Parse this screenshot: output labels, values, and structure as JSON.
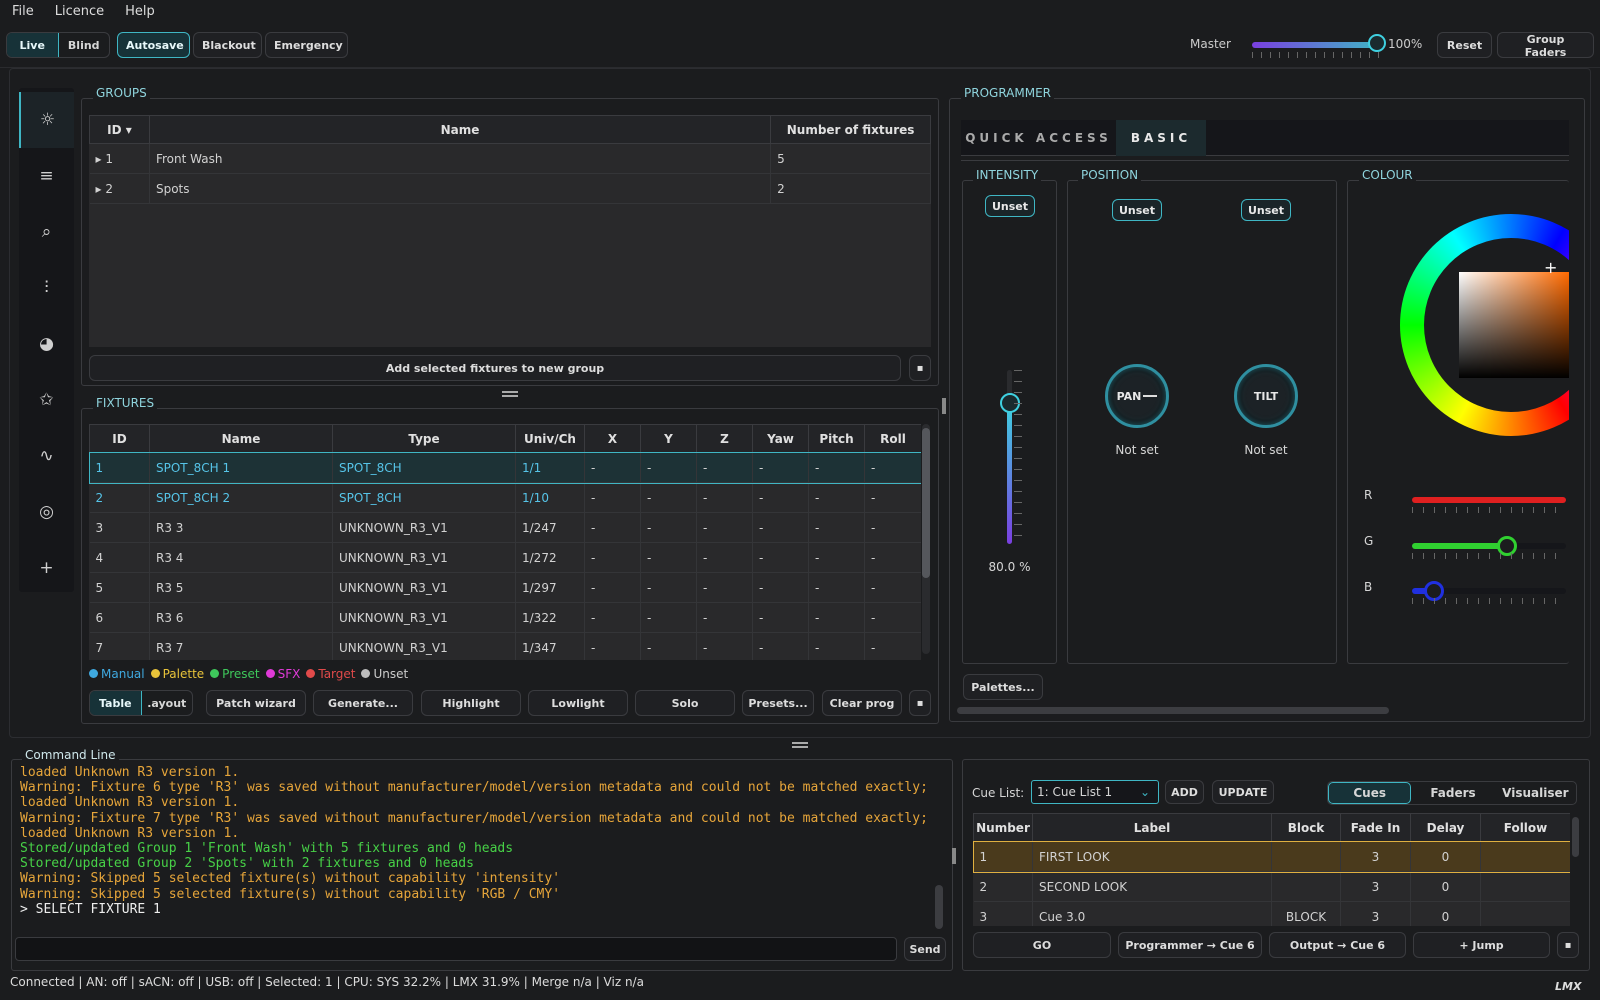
{
  "menu": [
    "File",
    "Licence",
    "Help"
  ],
  "toolbar": {
    "live": "Live",
    "blind": "Blind",
    "autosave": "Autosave",
    "blackout": "Blackout",
    "emergency": "Emergency",
    "master_label": "Master",
    "master_value": "100%",
    "master_level": 1.0,
    "reset": "Reset",
    "group_faders": "Group Faders"
  },
  "groups": {
    "title": "GROUPS",
    "columns": [
      "ID",
      "Name",
      "Number of fixtures"
    ],
    "rows": [
      {
        "id": "▸ 1",
        "name": "Front Wash",
        "count": "5"
      },
      {
        "id": "▸ 2",
        "name": "Spots",
        "count": "2"
      }
    ],
    "add_button": "Add selected fixtures to new group"
  },
  "fixtures": {
    "title": "FIXTURES",
    "columns": [
      "ID",
      "Name",
      "Type",
      "Univ/Ch",
      "X",
      "Y",
      "Z",
      "Yaw",
      "Pitch",
      "Roll"
    ],
    "rows": [
      [
        "1",
        "SPOT_8CH 1",
        "SPOT_8CH",
        "1/1",
        "-",
        "-",
        "-",
        "-",
        "-",
        "-"
      ],
      [
        "2",
        "SPOT_8CH 2",
        "SPOT_8CH",
        "1/10",
        "-",
        "-",
        "-",
        "-",
        "-",
        "-"
      ],
      [
        "3",
        "R3 3",
        "UNKNOWN_R3_V1",
        "1/247",
        "-",
        "-",
        "-",
        "-",
        "-",
        "-"
      ],
      [
        "4",
        "R3 4",
        "UNKNOWN_R3_V1",
        "1/272",
        "-",
        "-",
        "-",
        "-",
        "-",
        "-"
      ],
      [
        "5",
        "R3 5",
        "UNKNOWN_R3_V1",
        "1/297",
        "-",
        "-",
        "-",
        "-",
        "-",
        "-"
      ],
      [
        "6",
        "R3 6",
        "UNKNOWN_R3_V1",
        "1/322",
        "-",
        "-",
        "-",
        "-",
        "-",
        "-"
      ],
      [
        "7",
        "R3 7",
        "UNKNOWN_R3_V1",
        "1/347",
        "-",
        "-",
        "-",
        "-",
        "-",
        "-"
      ]
    ],
    "legend": [
      {
        "label": "Manual",
        "color": "#3fa9e0"
      },
      {
        "label": "Palette",
        "color": "#e8c33a"
      },
      {
        "label": "Preset",
        "color": "#3ec85b"
      },
      {
        "label": "SFX",
        "color": "#e03ad8"
      },
      {
        "label": "Target",
        "color": "#e04a4a"
      },
      {
        "label": "Unset",
        "color": "#bdbdbd"
      }
    ],
    "buttons": {
      "table": "Table",
      "layout": ".ayout",
      "patch": "Patch wizard",
      "generate": "Generate...",
      "highlight": "Highlight",
      "lowlight": "Lowlight",
      "solo": "Solo",
      "presets": "Presets...",
      "clear": "Clear prog"
    }
  },
  "programmer": {
    "title": "PROGRAMMER",
    "tabs": [
      "QUICK ACCESS",
      "BASIC"
    ],
    "intensity": {
      "title": "INTENSITY",
      "unset": "Unset",
      "value": "80.0 %",
      "level": 0.8
    },
    "position": {
      "title": "POSITION",
      "unset": "Unset",
      "pan": "PAN",
      "tilt": "TILT",
      "pan_state": "Not set",
      "tilt_state": "Not set"
    },
    "colour": {
      "title": "COLOUR",
      "r": "R",
      "g": "G",
      "b": "B",
      "r_level": 1.0,
      "g_level": 0.62,
      "b_level": 0.14
    },
    "palettes": "Palettes..."
  },
  "command": {
    "title": "Command Line",
    "log": [
      {
        "t": "loaded Unknown R3 version 1.",
        "c": "warn"
      },
      {
        "t": "Warning: Fixture 6 type 'R3' was saved without manufacturer/model/version metadata and could not be matched exactly;",
        "c": "warn"
      },
      {
        "t": "loaded Unknown R3 version 1.",
        "c": "warn"
      },
      {
        "t": "Warning: Fixture 7 type 'R3' was saved without manufacturer/model/version metadata and could not be matched exactly;",
        "c": "warn"
      },
      {
        "t": "loaded Unknown R3 version 1.",
        "c": "warn"
      },
      {
        "t": "Stored/updated Group 1 'Front Wash' with 5 fixtures and 0 heads",
        "c": "ok"
      },
      {
        "t": "Stored/updated Group 2 'Spots' with 2 fixtures and 0 heads",
        "c": "ok"
      },
      {
        "t": "Warning: Skipped 5 selected fixture(s) without capability 'intensity'",
        "c": "warn"
      },
      {
        "t": "Warning: Skipped 5 selected fixture(s) without capability 'RGB / CMY'",
        "c": "warn"
      },
      {
        "t": "> SELECT FIXTURE 1",
        "c": "cmd"
      }
    ],
    "send": "Send"
  },
  "cues": {
    "label": "Cue List:",
    "selected": "1: Cue List 1",
    "add": "ADD",
    "update": "UPDATE",
    "tabs": [
      "Cues",
      "Faders",
      "Visualiser"
    ],
    "columns": [
      "Number",
      "Label",
      "Block",
      "Fade In",
      "Delay",
      "Follow"
    ],
    "rows": [
      [
        "1",
        "FIRST LOOK",
        "",
        "3",
        "0",
        ""
      ],
      [
        "2",
        "SECOND LOOK",
        "",
        "3",
        "0",
        ""
      ],
      [
        "3",
        "Cue 3.0",
        "BLOCK",
        "3",
        "0",
        ""
      ]
    ],
    "go": "GO",
    "prog_cue": "Programmer → Cue 6",
    "out_cue": "Output → Cue 6",
    "jump": "+ Jump"
  },
  "status": "Connected | AN: off | sACN: off | USB: off | Selected: 1 | CPU: SYS 32.2% | LMX 31.9% | Merge n/a | Viz n/a",
  "logo": "LMX",
  "colors": {
    "accent": "#3fb6c4",
    "warn": "#e6a53a",
    "ok": "#47d147"
  }
}
